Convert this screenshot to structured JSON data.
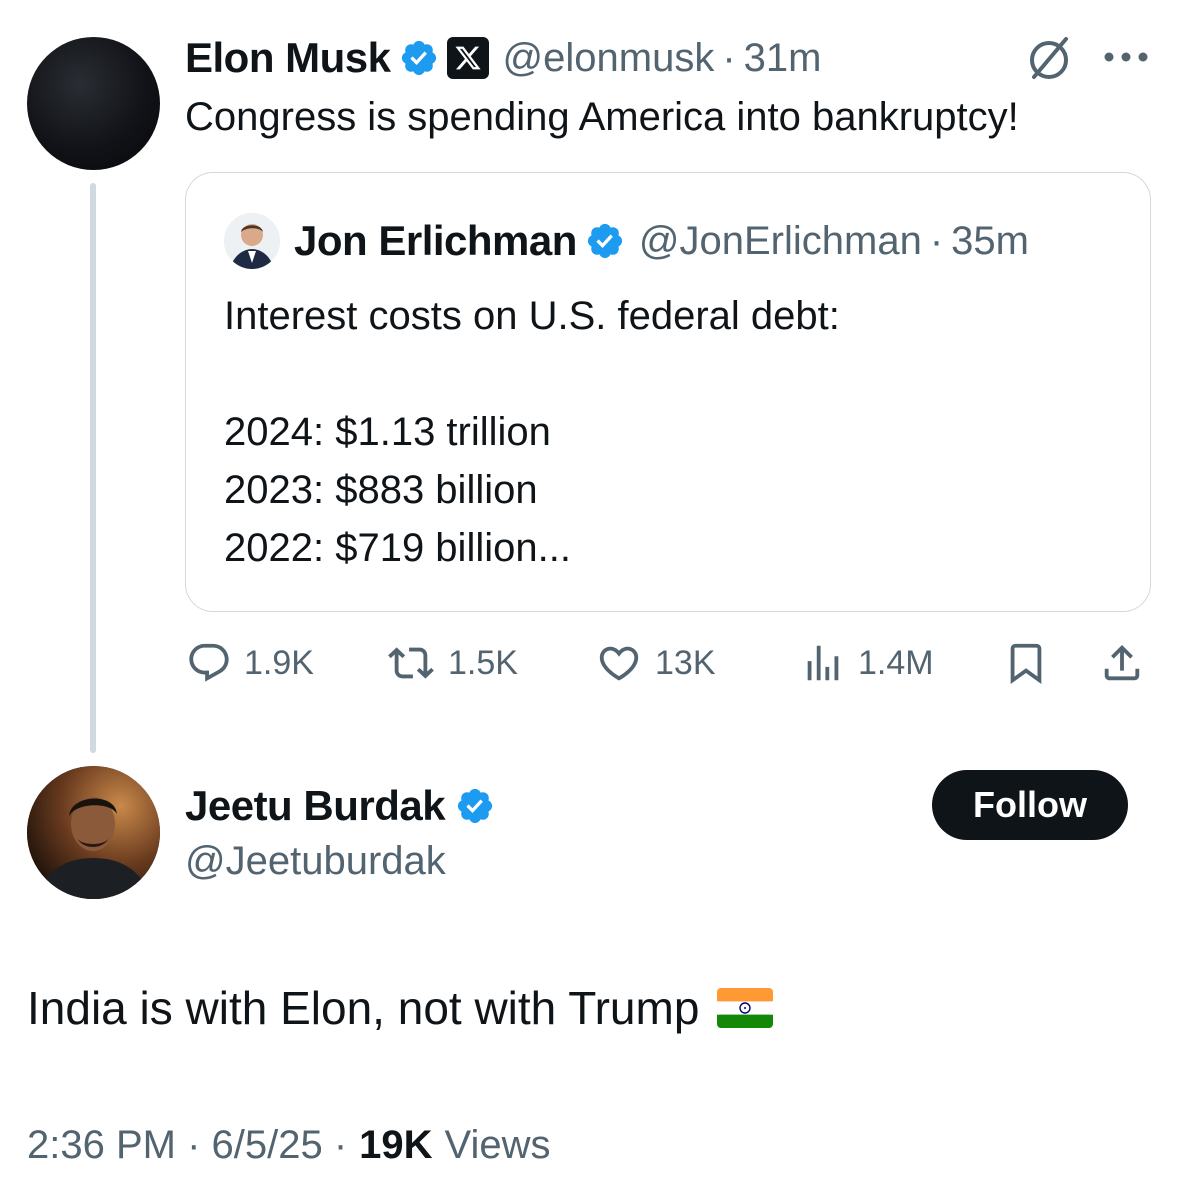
{
  "parent_tweet": {
    "author_name": "Elon Musk",
    "handle": "@elonmusk",
    "separator": "·",
    "time": "31m",
    "text": "Congress is spending America into bankruptcy!",
    "badges": [
      "verified-badge-icon",
      "x-affiliate-icon"
    ]
  },
  "quoted_tweet": {
    "author_name": "Jon Erlichman",
    "handle": "@JonErlichman",
    "separator": "·",
    "time": "35m",
    "lines": [
      "Interest costs on U.S. federal debt:",
      "",
      "2024: $1.13 trillion",
      "2023: $883 billion",
      "2022: $719 billion..."
    ]
  },
  "actions": {
    "replies": "1.9K",
    "reposts": "1.5K",
    "likes": "13K",
    "views": "1.4M"
  },
  "reply_tweet": {
    "author_name": "Jeetu Burdak",
    "handle": "@Jeetuburdak",
    "follow_label": "Follow",
    "text": "India is with Elon, not with Trump",
    "emoji": "india-flag",
    "timestamp": "2:36 PM · 6/5/25 ·",
    "views_count": "19K",
    "views_label": "Views"
  },
  "colors": {
    "verified": "#1d9bf0",
    "muted": "#536471",
    "border": "#cfd9de",
    "thread_line": "#cfd9de",
    "text": "#0f1419"
  }
}
